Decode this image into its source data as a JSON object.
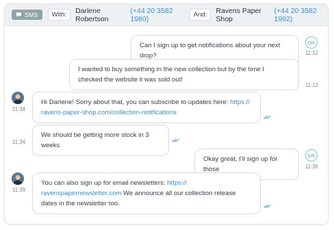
{
  "header": {
    "channel_label": "SMS",
    "channel_icon": "chat-bubble-icon",
    "with_label": "With:",
    "customer_name": "Darlene Robertson",
    "customer_phone": "(+44 20 3582 1980)",
    "and_label": "And:",
    "business_name": "Ravens Paper Shop",
    "business_phone": "(+44 20 3582 1992)"
  },
  "customer_initials": "DR",
  "colors": {
    "link": "#3d8fd0",
    "badge": "#8fa4a5",
    "read_ticks": "#3d8fd0",
    "avatar_ring": "#7cc7c5"
  },
  "messages": [
    {
      "from": "customer",
      "text": "Can I sign up to get notifications about your next drop?",
      "time": "11:12"
    },
    {
      "from": "customer",
      "text": "I wanted to buy something in the new collection but by the time I checked the website it was sold out!",
      "time": "11:12"
    },
    {
      "from": "business",
      "text_before": "Hi Darlene! Sorry about that, you can subscribe to updates here: ",
      "link": "https:// ravens-paper-shop.com/collection-notifications",
      "text_after": "",
      "time": "11:34",
      "status": "read"
    },
    {
      "from": "business",
      "text": "We should be getting more stock in 3 weeks",
      "time": "11:34",
      "status": "read"
    },
    {
      "from": "customer",
      "text": "Okay great, I'll sign up for those",
      "time": "11:36"
    },
    {
      "from": "business",
      "text_before": "You can also sign up for email newsletters: ",
      "link": "https:// ravenspapernewsletter.com",
      "text_after": " We announce all our collection release dates in the newsletter too.",
      "time": "11:39",
      "status": "read"
    }
  ]
}
